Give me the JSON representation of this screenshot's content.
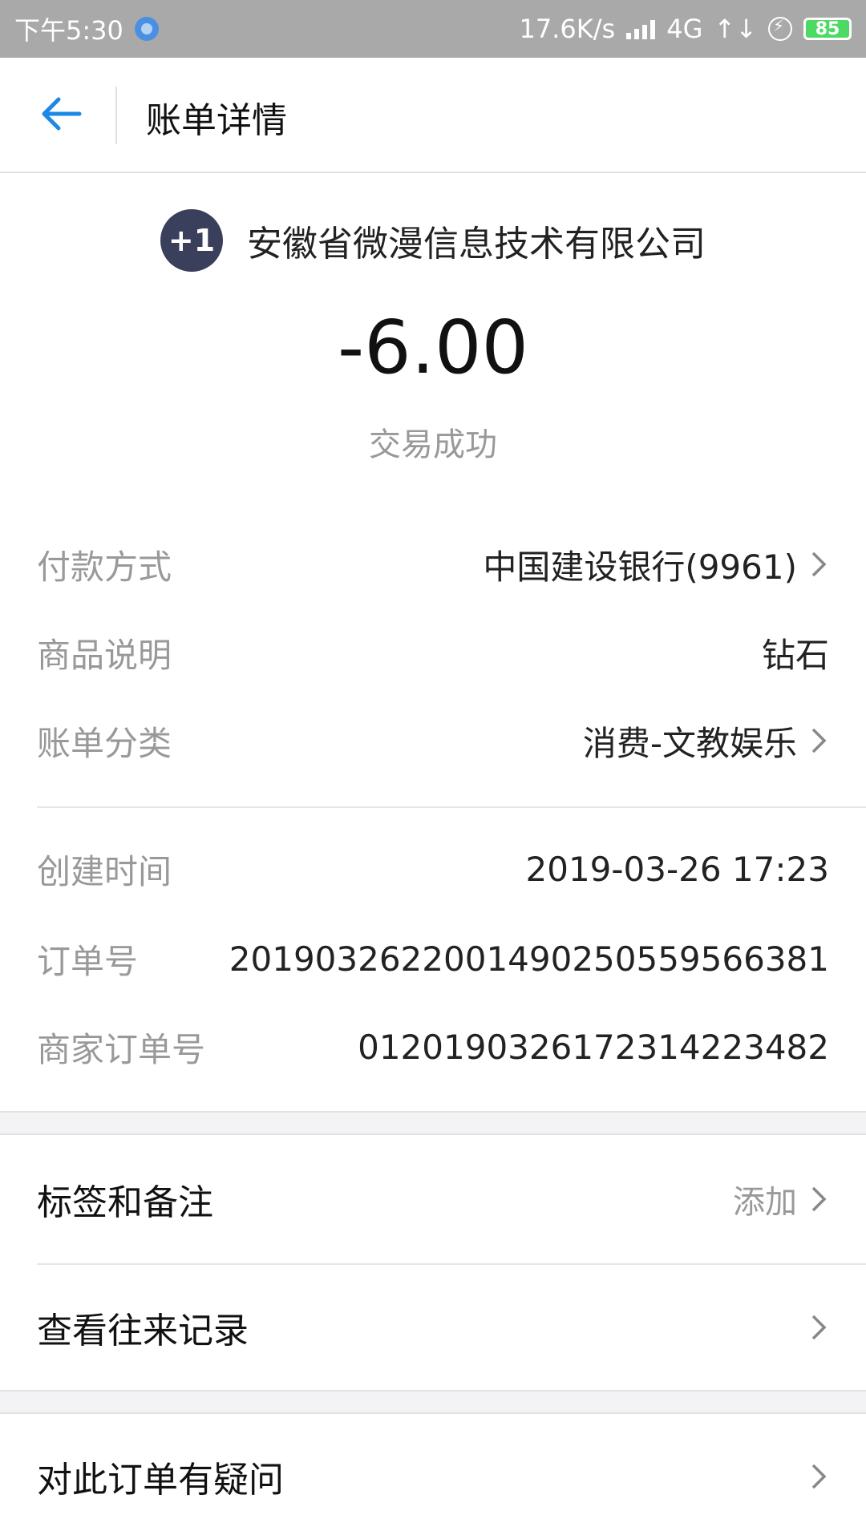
{
  "status_bar": {
    "time": "下午5:30",
    "speed": "17.6K/s",
    "network": "4G",
    "battery": "85"
  },
  "header": {
    "title": "账单详情"
  },
  "merchant": {
    "logo_text": "+1",
    "name": "安徽省微漫信息技术有限公司"
  },
  "amount": "-6.00",
  "status": "交易成功",
  "details": [
    {
      "label": "付款方式",
      "value": "中国建设银行(9961)"
    },
    {
      "label": "商品说明",
      "value": "钻石"
    },
    {
      "label": "账单分类",
      "value": "消费-文教娱乐"
    },
    {
      "label": "创建时间",
      "value": "2019-03-26 17:23"
    },
    {
      "label": "订单号",
      "value": "2019032622001490250559566381"
    },
    {
      "label": "商家订单号",
      "value": "01201903261723142234​82"
    }
  ],
  "actions": [
    {
      "label": "标签和备注",
      "value": "添加"
    },
    {
      "label": "查看往来记录",
      "value": ""
    },
    {
      "label": "对此订单有疑问",
      "value": ""
    }
  ]
}
